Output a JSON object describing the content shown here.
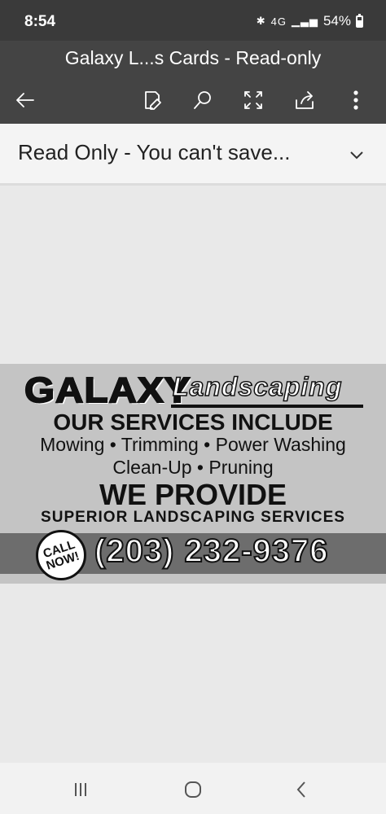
{
  "status_bar": {
    "time": "8:54",
    "network": "4G",
    "battery": "54%"
  },
  "header": {
    "title": "Galaxy L...s Cards - Read-only",
    "toolbar": [
      "back-arrow-icon",
      "edit-icon",
      "search-icon",
      "fullscreen-icon",
      "share-icon",
      "more-icon"
    ]
  },
  "banner": {
    "text": "Read Only - You can't save..."
  },
  "document": {
    "brand_name": "GALAXY",
    "brand_sub": "Landscaping",
    "services_heading": "OUR SERVICES INCLUDE",
    "services_line1": "Mowing • Trimming • Power Washing",
    "services_line2": "Clean-Up • Pruning",
    "provide_heading": "WE PROVIDE",
    "provide_sub": "SUPERIOR LANDSCAPING SERVICES",
    "call_badge_line1": "CALL",
    "call_badge_line2": "NOW!",
    "phone": "(203) 232-9376"
  },
  "colors": {
    "header_bg": "#444444",
    "status_bg": "#3a3a3a",
    "card_bg": "#c4c4c4",
    "phone_strip": "#6d6d6d"
  },
  "nav": [
    "recent-apps-icon",
    "home-icon",
    "back-icon"
  ]
}
